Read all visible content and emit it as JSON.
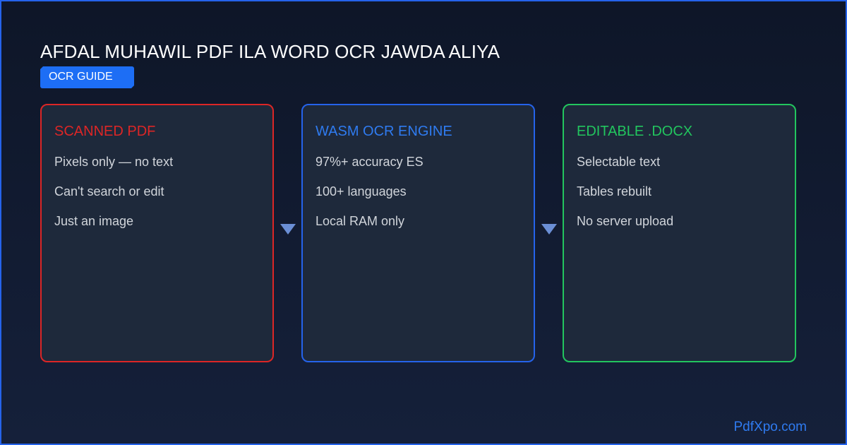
{
  "header": {
    "title": "AFDAL MUHAWIL PDF ILA WORD OCR JAWDA ALIYA",
    "badge": "OCR GUIDE"
  },
  "cards": [
    {
      "title": "SCANNED PDF",
      "accent": "#dc2626",
      "items": [
        "Pixels only — no text",
        "Can't search or edit",
        "Just an image"
      ]
    },
    {
      "title": "WASM OCR ENGINE",
      "accent": "#2563eb",
      "items": [
        "97%+ accuracy ES",
        "100+ languages",
        "Local RAM only"
      ]
    },
    {
      "title": "EDITABLE .DOCX",
      "accent": "#22c55e",
      "items": [
        "Selectable text",
        "Tables rebuilt",
        "No server upload"
      ]
    }
  ],
  "flow_arrows": [
    "down-arrow-icon",
    "down-arrow-icon"
  ],
  "footer": {
    "brand": "PdfXpo.com"
  }
}
